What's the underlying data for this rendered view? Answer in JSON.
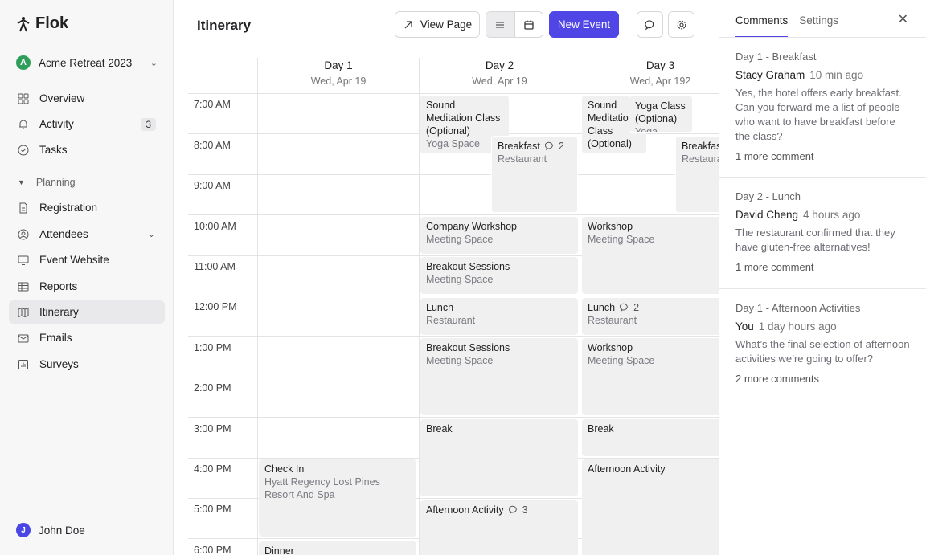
{
  "sidebar": {
    "brand": "Flok",
    "workspace": {
      "initial": "A",
      "name": "Acme Retreat 2023"
    },
    "items": [
      {
        "label": "Overview"
      },
      {
        "label": "Activity",
        "badge": "3"
      },
      {
        "label": "Tasks"
      }
    ],
    "section": "Planning",
    "planning": [
      {
        "label": "Registration"
      },
      {
        "label": "Attendees"
      },
      {
        "label": "Event Website"
      },
      {
        "label": "Reports"
      },
      {
        "label": "Itinerary"
      },
      {
        "label": "Emails"
      },
      {
        "label": "Surveys"
      }
    ],
    "user": {
      "initial": "J",
      "name": "John Doe"
    }
  },
  "header": {
    "title": "Itinerary",
    "view_page": "View Page",
    "new_event": "New Event"
  },
  "calendar": {
    "days": [
      {
        "name": "Day 1",
        "date": "Wed, Apr 19"
      },
      {
        "name": "Day 2",
        "date": "Wed, Apr 19"
      },
      {
        "name": "Day 3",
        "date": "Wed, Apr 192"
      }
    ],
    "times": [
      "7:00 AM",
      "8:00 AM",
      "9:00 AM",
      "10:00 AM",
      "11:00 AM",
      "12:00 PM",
      "1:00 PM",
      "2:00 PM",
      "3:00 PM",
      "4:00 PM",
      "5:00 PM",
      "6:00 PM"
    ],
    "events": {
      "d1_checkin": {
        "title": "Check In",
        "loc": "Hyatt Regency Lost Pines Resort And Spa"
      },
      "d1_dinner": {
        "title": "Dinner"
      },
      "d2_sound": {
        "title": "Sound Meditation Class (Optional)",
        "loc": "Yoga Space"
      },
      "d2_breakfast": {
        "title": "Breakfast",
        "comments": "2",
        "loc": "Restaurant"
      },
      "d2_workshop": {
        "title": "Company Workshop",
        "loc": "Meeting Space"
      },
      "d2_breakout1": {
        "title": "Breakout Sessions",
        "loc": "Meeting Space"
      },
      "d2_lunch": {
        "title": "Lunch",
        "loc": "Restaurant"
      },
      "d2_breakout2": {
        "title": "Breakout Sessions",
        "loc": "Meeting Space"
      },
      "d2_break": {
        "title": "Break"
      },
      "d2_afternoon": {
        "title": "Afternoon Activity",
        "comments": "3"
      },
      "d3_sound": {
        "title": "Sound Meditatio Class (Optional)"
      },
      "d3_yoga": {
        "title": "Yoga Class (Optiona)",
        "loc": "Yoga Space"
      },
      "d3_breakfast": {
        "title": "Breakfas",
        "loc": "Restaura"
      },
      "d3_workshop1": {
        "title": "Workshop",
        "loc": "Meeting Space"
      },
      "d3_lunch": {
        "title": "Lunch",
        "comments": "2",
        "loc": "Restaurant"
      },
      "d3_workshop2": {
        "title": "Workshop",
        "loc": "Meeting Space"
      },
      "d3_break": {
        "title": "Break"
      },
      "d3_afternoon": {
        "title": "Afternoon Activity"
      }
    }
  },
  "panel": {
    "tabs": [
      "Comments",
      "Settings"
    ],
    "threads": [
      {
        "title": "Day 1 - Breakfast",
        "author": "Stacy Graham",
        "ago": "10 min ago",
        "message": "Yes, the hotel offers early breakfast. Can you forward me a list of people who want to have breakfast before the class?",
        "more": "1 more comment"
      },
      {
        "title": "Day 2 - Lunch",
        "author": "David Cheng",
        "ago": "4 hours ago",
        "message": "The restaurant confirmed that they have gluten-free alternatives!",
        "more": "1 more comment"
      },
      {
        "title": "Day 1 - Afternoon Activities",
        "author": "You",
        "ago": "1 day hours ago",
        "message": "What’s the final selection of afternoon activities we’re going to offer?",
        "more": "2 more comments"
      }
    ]
  },
  "colors": {
    "accent": "#4f46e5",
    "workspace_avatar": "#2f9e5b",
    "event_bg": "#f0f0f1"
  }
}
